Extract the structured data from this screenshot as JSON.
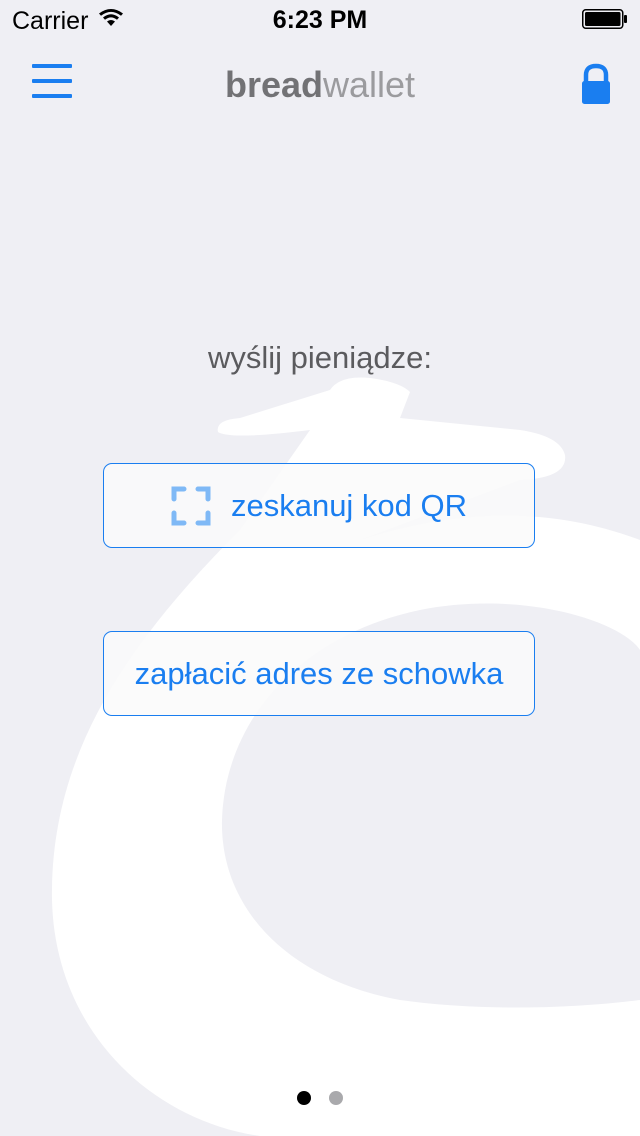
{
  "status_bar": {
    "carrier": "Carrier",
    "time": "6:23 PM"
  },
  "nav": {
    "brand_bold": "bread",
    "brand_light": "wallet",
    "menu_icon": "hamburger-menu-icon",
    "lock_icon": "lock-icon"
  },
  "content": {
    "prompt": "wyślij pieniądze:",
    "scan_button_label": "zeskanuj kod QR",
    "scan_icon": "qr-scan-icon",
    "paste_button_label": "zapłacić adres ze schowka"
  },
  "pager": {
    "page_count": 2,
    "current_page": 1
  },
  "colors": {
    "accent": "#1a7ef0",
    "background": "#efeff4",
    "text_gray": "#5b5b5e"
  }
}
